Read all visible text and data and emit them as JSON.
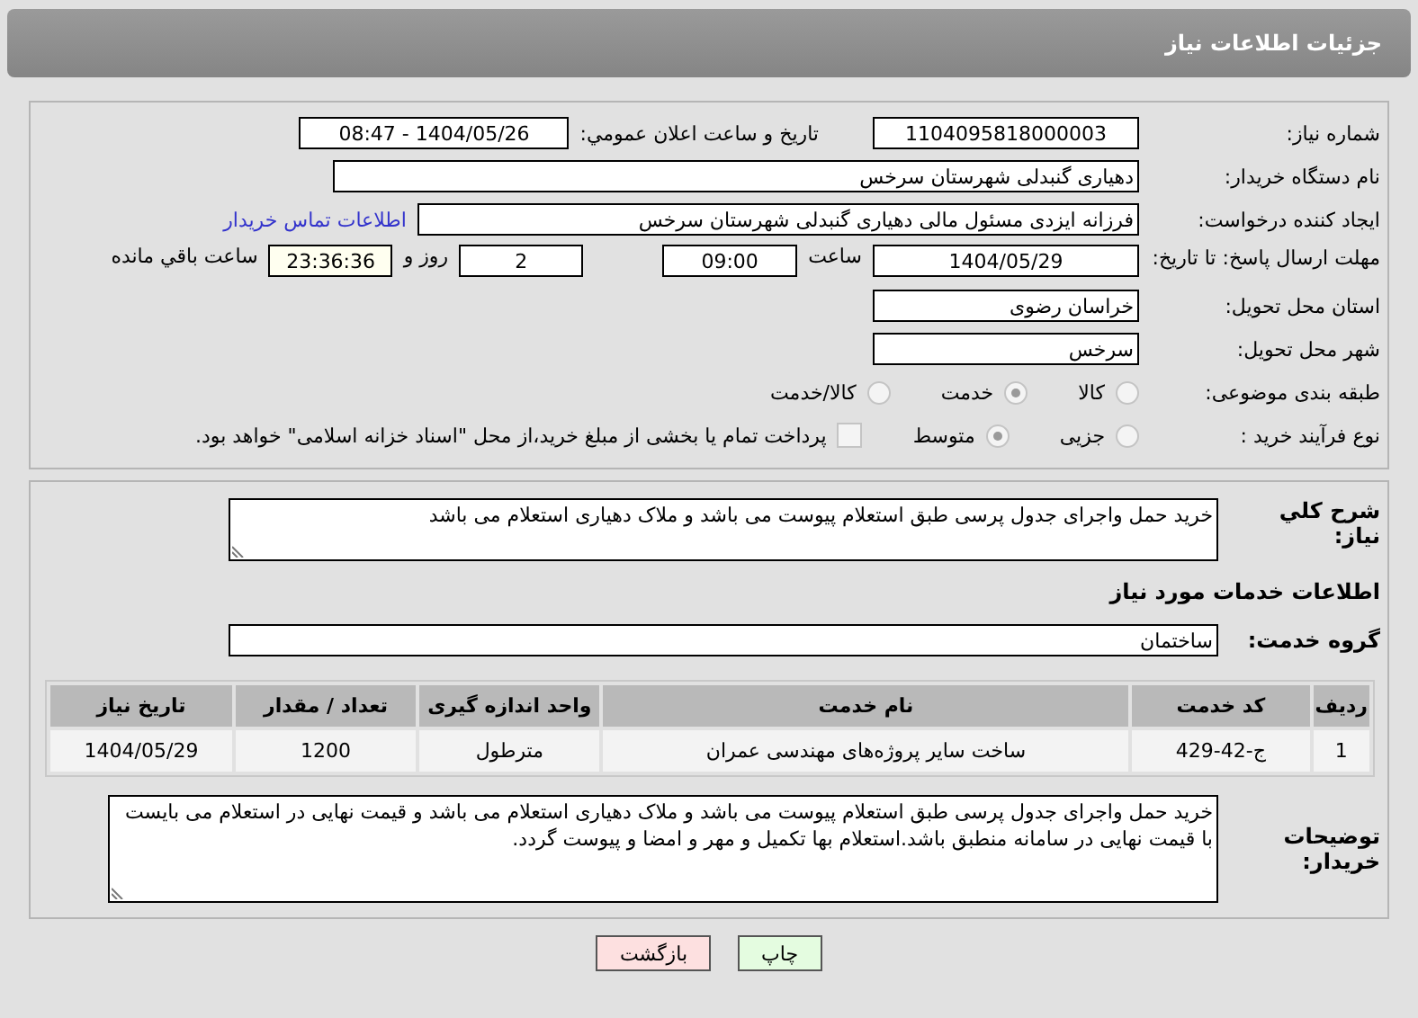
{
  "header": {
    "title": "جزئیات اطلاعات نیاز"
  },
  "need_number": {
    "label": "شماره نیاز:",
    "value": "1104095818000003"
  },
  "announce": {
    "label": "تاریخ و ساعت اعلان عمومي:",
    "value": "1404/05/26 - 08:47"
  },
  "buyer_org": {
    "label": "نام دستگاه خریدار:",
    "value": "دهیاری گنبدلی شهرستان سرخس"
  },
  "creator": {
    "label": "ایجاد کننده درخواست:",
    "value": "فرزانه ایزدی مسئول مالی دهیاری گنبدلی شهرستان سرخس",
    "link": "اطلاعات تماس خریدار"
  },
  "deadline": {
    "label": "مهلت ارسال پاسخ: تا تاریخ:",
    "date": "1404/05/29",
    "time_label": "ساعت",
    "time": "09:00",
    "days": "2",
    "days_label": "روز و",
    "remaining": "23:36:36",
    "remaining_label": "ساعت باقي مانده"
  },
  "province": {
    "label": "استان محل تحویل:",
    "value": "خراسان رضوی"
  },
  "city": {
    "label": "شهر محل تحویل:",
    "value": "سرخس"
  },
  "category": {
    "label": "طبقه بندی موضوعی:",
    "options": [
      {
        "label": "کالا",
        "selected": false
      },
      {
        "label": "خدمت",
        "selected": true
      },
      {
        "label": "کالا/خدمت",
        "selected": false
      }
    ]
  },
  "process": {
    "label": "نوع فرآیند خرید :",
    "options": [
      {
        "label": "جزیی",
        "selected": false
      },
      {
        "label": "متوسط",
        "selected": true
      }
    ],
    "treasury": {
      "checked": false,
      "text": "پرداخت تمام یا بخشی از مبلغ خرید،از محل \"اسناد خزانه اسلامی\" خواهد بود."
    }
  },
  "description": {
    "label": "شرح کلي نیاز:",
    "value": "خرید حمل واجرای جدول پرسی طبق استعلام پیوست می باشد و ملاک دهیاری استعلام می باشد"
  },
  "services_heading": "اطلاعات خدمات مورد نیاز",
  "service_group": {
    "label": "گروه خدمت:",
    "value": "ساختمان"
  },
  "table": {
    "columns": [
      "ردیف",
      "کد خدمت",
      "نام خدمت",
      "واحد اندازه گیری",
      "تعداد / مقدار",
      "تاریخ نیاز"
    ],
    "rows": [
      [
        "1",
        "ج-42-429",
        "ساخت سایر پروژه‌های مهندسی عمران",
        "مترطول",
        "1200",
        "1404/05/29"
      ]
    ]
  },
  "buyer_notes": {
    "label": "توضیحات خریدار:",
    "value": "خرید حمل واجرای جدول پرسی طبق استعلام پیوست می باشد و ملاک دهیاری استعلام می باشد و قیمت نهایی در استعلام می بایست با قیمت نهایی در سامانه منطبق باشد.استعلام بها تکمیل و مهر و امضا و پیوست گردد."
  },
  "buttons": [
    {
      "label": "چاپ",
      "kind": "print"
    },
    {
      "label": "بازگشت",
      "kind": "back"
    }
  ]
}
